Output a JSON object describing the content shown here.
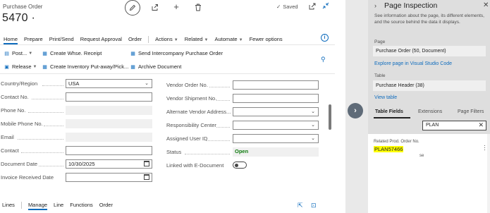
{
  "header": {
    "page_type": "Purchase Order",
    "number": "5470 ·",
    "status": "Saved"
  },
  "actionbar": {
    "home": "Home",
    "prepare": "Prepare",
    "print_send": "Print/Send",
    "request_approval": "Request Approval",
    "order": "Order",
    "actions": "Actions",
    "related": "Related",
    "automate": "Automate",
    "fewer_options": "Fewer options"
  },
  "commands": {
    "post": "Post...",
    "release": "Release",
    "create_whse_receipt": "Create Whse. Receipt",
    "create_inventory_put_away": "Create Inventory Put-away/Pick...",
    "send_intercompany": "Send Intercompany Purchase Order",
    "archive_document": "Archive Document"
  },
  "form": {
    "left": [
      {
        "label": "Country/Region",
        "value": "USA"
      },
      {
        "label": "Contact No.",
        "value": ""
      },
      {
        "label": "Phone No.",
        "value": ""
      },
      {
        "label": "Mobile Phone No.",
        "value": ""
      },
      {
        "label": "Email",
        "value": ""
      },
      {
        "label": "Contact",
        "value": ""
      },
      {
        "label": "Document Date",
        "value": "10/30/2025"
      },
      {
        "label": "Invoice Received Date",
        "value": ""
      }
    ],
    "right": [
      {
        "label": "Vendor Order No.",
        "value": ""
      },
      {
        "label": "Vendor Shipment No.",
        "value": ""
      },
      {
        "label": "Alternate Vendor Address...",
        "value": ""
      },
      {
        "label": "Responsibility Center",
        "value": ""
      },
      {
        "label": "Assigned User ID",
        "value": ""
      },
      {
        "label": "Status",
        "value": "Open"
      },
      {
        "label": "Linked with E-Document",
        "value": ""
      }
    ]
  },
  "lines_bar": {
    "lines": "Lines",
    "manage": "Manage",
    "line": "Line",
    "functions": "Functions",
    "order": "Order"
  },
  "inspection": {
    "title": "Page Inspection",
    "description": "See information about the page, its different elements, and the source behind the data it displays.",
    "page_label": "Page",
    "page_value": "Purchase Order (50, Document)",
    "explore_link": "Explore page in Visual Studio Code",
    "table_label": "Table",
    "table_value": "Purchase Header (38)",
    "view_table": "View table",
    "tabs": [
      "Table Fields",
      "Extensions",
      "Page Filters"
    ],
    "filter_value": "PLAN",
    "field_name": "Related Prod. Order No.",
    "field_value": "PLAN57466",
    "field_extra": "se"
  }
}
